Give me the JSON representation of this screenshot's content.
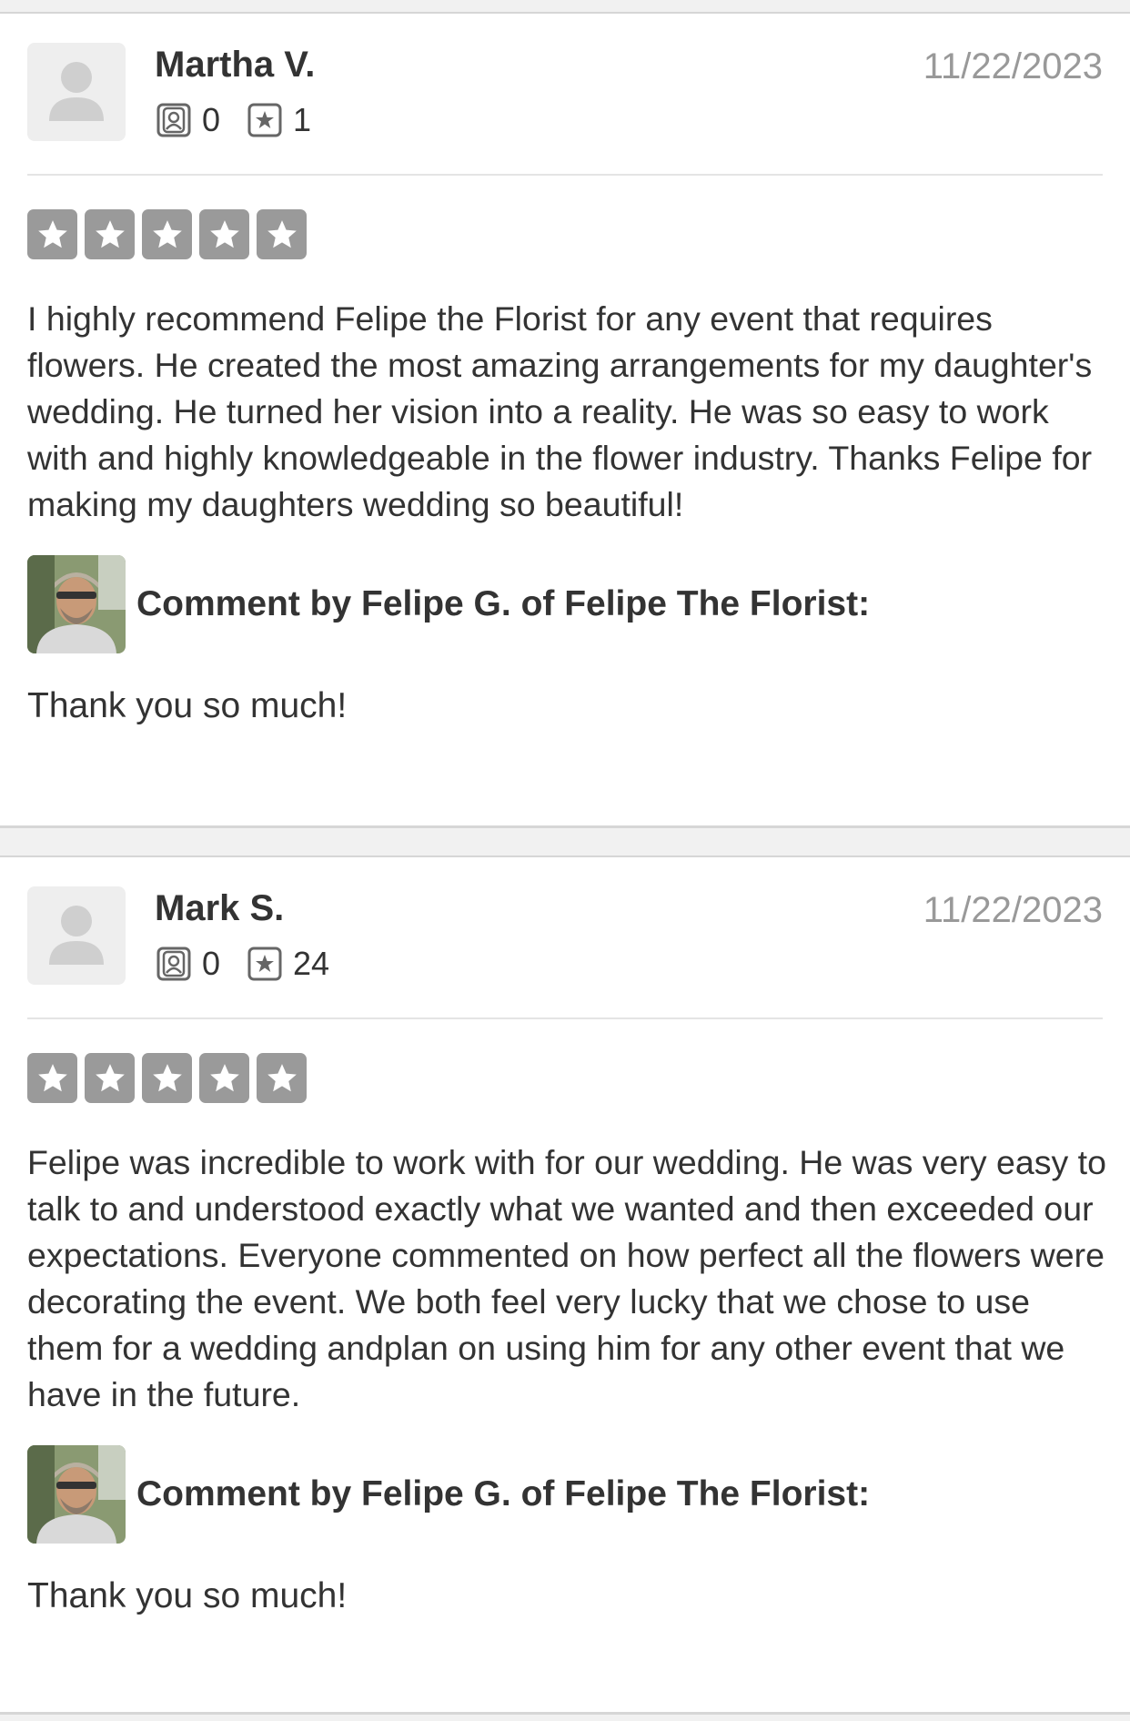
{
  "reviews": [
    {
      "name": "Martha V.",
      "date": "11/22/2023",
      "friends_count": "0",
      "reviews_count": "1",
      "rating": 5,
      "text": "I highly recommend Felipe the Florist for any event that requires flowers. He created the most amazing arrangements for my daughter's wedding. He turned her vision into a reality. He was so easy to work with and highly knowledgeable in the flower industry. Thanks Felipe for making my daughters wedding so beautiful!",
      "comment_label": "Comment by Felipe G. of Felipe The Florist:",
      "reply": "Thank you so much!"
    },
    {
      "name": "Mark S.",
      "date": "11/22/2023",
      "friends_count": "0",
      "reviews_count": "24",
      "rating": 5,
      "text": "Felipe was incredible to work with for our wedding. He was very easy to talk to and understood exactly what we wanted and then exceeded our expectations. Everyone commented on how perfect all the flowers were decorating the event. We both feel very lucky that we chose to use them for a wedding andplan on using him for any other event that we have in the future.",
      "comment_label": "Comment by Felipe G. of Felipe The Florist:",
      "reply": "Thank you so much!"
    }
  ],
  "colors": {
    "star": "#9a9a9a",
    "date": "#999999",
    "text": "#333333"
  }
}
